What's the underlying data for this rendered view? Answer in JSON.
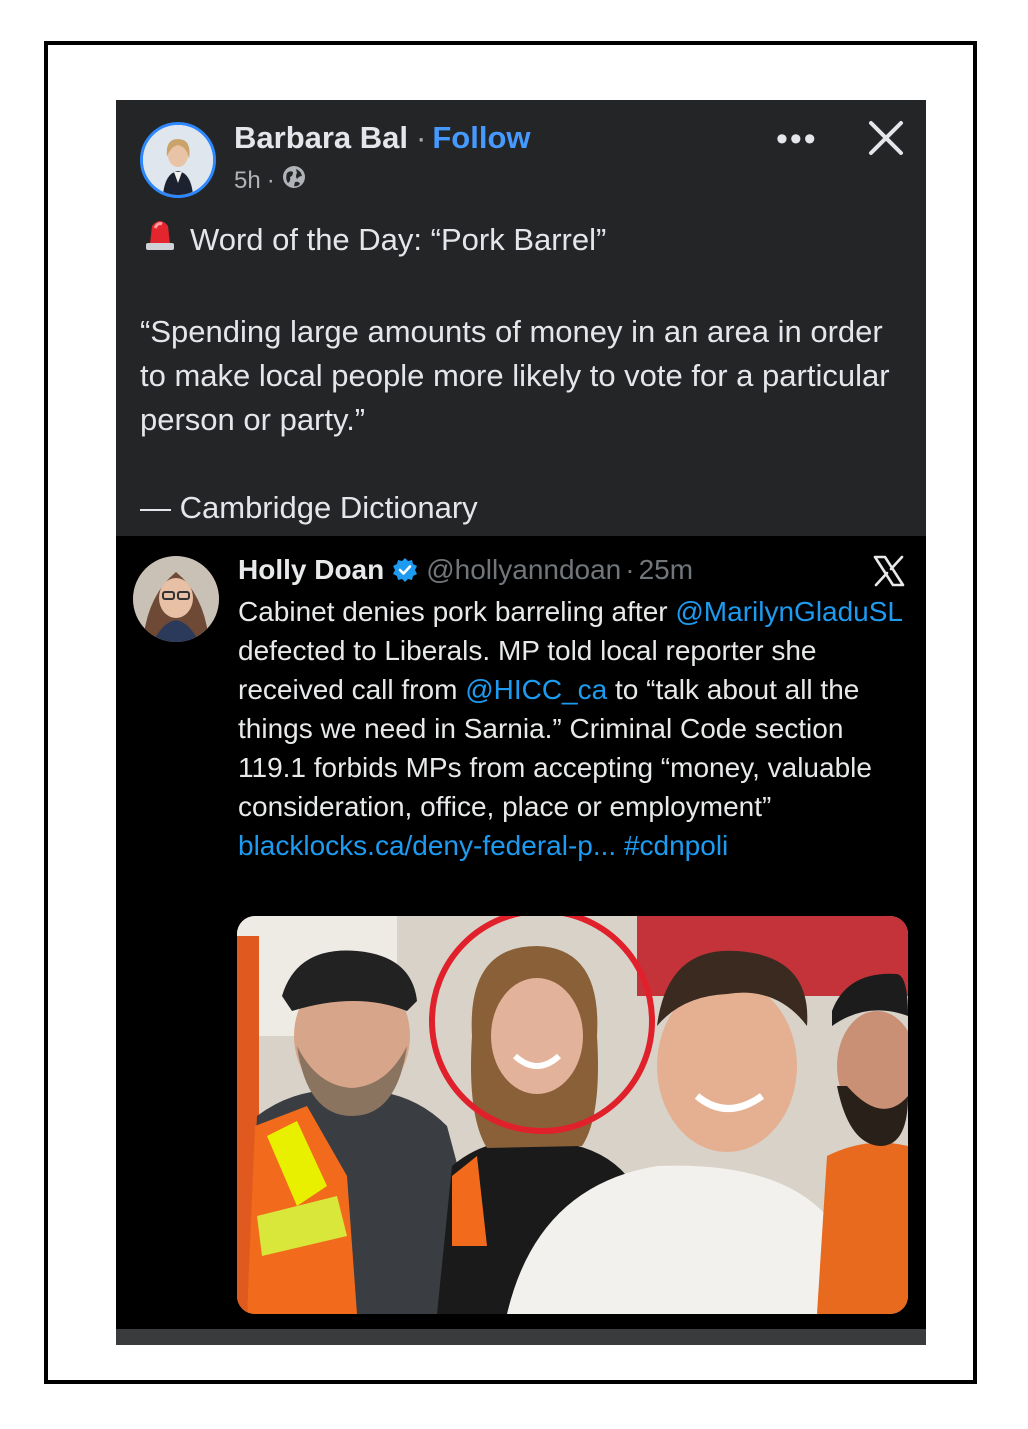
{
  "post": {
    "author": "Barbara Bal",
    "separator": "·",
    "follow_label": "Follow",
    "time": "5h",
    "time_separator": "·",
    "more_label": "•••",
    "word_of_day": "Word of the Day: “Pork Barrel”",
    "definition": "“Spending large amounts of money in an area in order to make local people more likely to vote for a particular person or party.”",
    "source": "— Cambridge Dictionary"
  },
  "tweet": {
    "name": "Holly Doan",
    "handle": "@hollyanndoan",
    "separator": "·",
    "time": "25m",
    "text_1": "Cabinet denies pork barreling after ",
    "mention_1": "@MarilynGladuSL",
    "text_2": " defected to Liberals.  MP told local reporter she received call from ",
    "mention_2": "@HICC_ca",
    "text_3": " to “talk about all the things we need in Sarnia.” Criminal Code section 119.1 forbids MPs from accepting “money, valuable consideration, office, place or employment”",
    "link": "blacklocks.ca/deny-federal-p...",
    "hashtag": "#cdnpoli"
  },
  "colors": {
    "post_bg": "#242526",
    "tweet_bg": "#000000",
    "follow_blue": "#4599ff",
    "link_blue": "#1d9bf0",
    "verified_blue": "#1d9bf0",
    "circle_red": "#e0202a"
  },
  "icons": {
    "globe": "globe-icon",
    "siren": "siren-emoji-icon",
    "close": "close-icon",
    "more": "more-options-icon",
    "x_logo": "x-logo-icon",
    "verified": "verified-badge-icon"
  }
}
